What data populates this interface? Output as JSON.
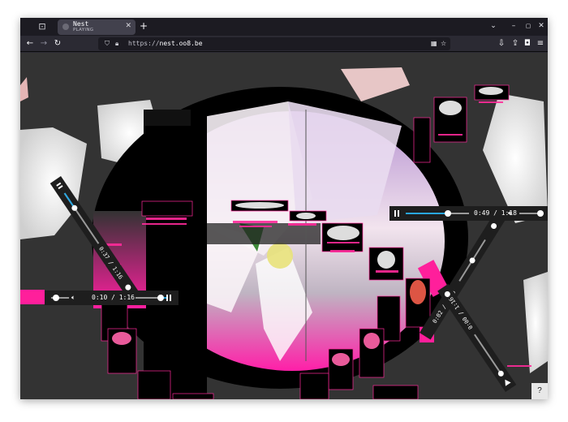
{
  "browser": {
    "tab": {
      "title": "Nest",
      "subtitle": "PLAYING",
      "close": "✕"
    },
    "new_tab": "+",
    "tab_list": "⌄",
    "window_controls": {
      "minimize": "–",
      "maximize": "▢",
      "close": "✕"
    },
    "nav": {
      "back": "←",
      "forward": "→",
      "reload": "↻"
    },
    "url": {
      "prefix": "https://",
      "host": "nest.oo8.be"
    },
    "icons": {
      "shield": "shield-icon",
      "lock": "lock-icon",
      "extensions": "puzzle-icon",
      "bookmark": "star-icon",
      "pocket": "pocket-icon",
      "share": "share-icon",
      "menu": "hamburger-menu-icon"
    }
  },
  "players": [
    {
      "time": "0:49 / 1:18",
      "volume_icon": "speaker-icon"
    },
    {
      "time": "0:10 / 1:16",
      "volume_icon": "speaker-icon"
    },
    {
      "time": "0:37 / 1:16",
      "volume_icon": "speaker-icon"
    },
    {
      "time": "0:02 / 1:16",
      "volume_icon": "speaker-icon"
    },
    {
      "time": "0:00 / 1:16",
      "volume_icon": "speaker-icon"
    }
  ],
  "help": {
    "label": "?"
  },
  "colors": {
    "accent": "#ff1f9b",
    "progress": "#29a6e0",
    "background": "#333333"
  }
}
